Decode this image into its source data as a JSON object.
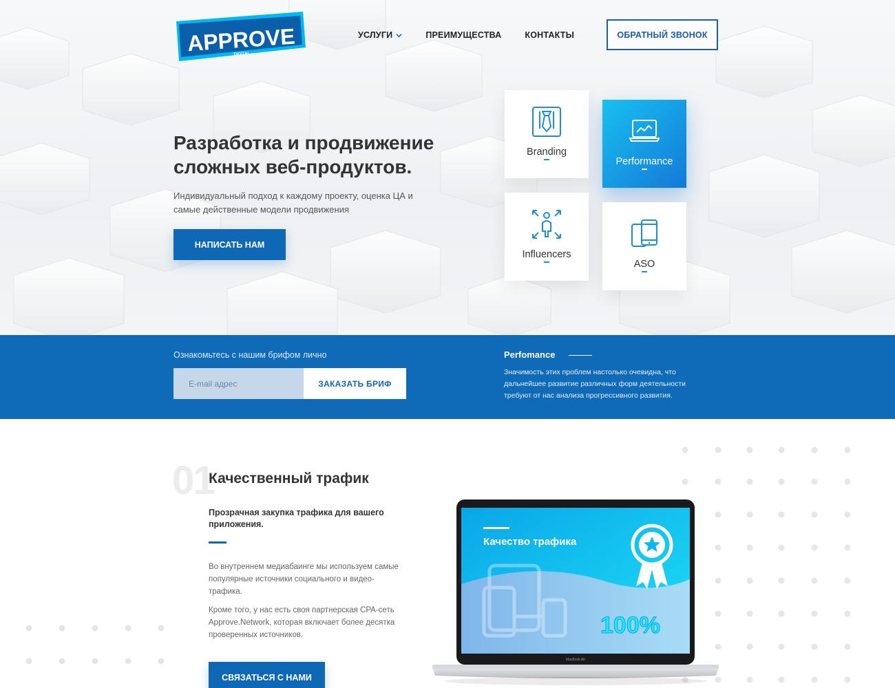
{
  "logo": {
    "main": "APPROVE",
    "sub": "DIGITAL"
  },
  "nav": {
    "items": [
      {
        "label": "УСЛУГИ"
      },
      {
        "label": "ПРЕИМУЩЕСТВА"
      },
      {
        "label": "КОНТАКТЫ"
      }
    ],
    "callback_label": "ОБРАТНЫЙ ЗВОНОК"
  },
  "hero": {
    "title": "Разработка и продвижение сложных веб-продуктов.",
    "subtitle": "Индивидуальный подход к каждому проекту, оценка ЦА и самые действенные модели продвижения",
    "cta_label": "НАПИСАТЬ НАМ"
  },
  "services": [
    {
      "label": "Branding",
      "icon": "tie-icon"
    },
    {
      "label": "Performance",
      "icon": "laptop-chart-icon",
      "active": true
    },
    {
      "label": "Influencers",
      "icon": "person-arrows-icon"
    },
    {
      "label": "ASO",
      "icon": "phones-icon"
    }
  ],
  "brief": {
    "label": "Ознакомьтесь с нашим брифом лично",
    "email_placeholder": "E-mail адрес",
    "button_label": "ЗАКАЗАТЬ БРИФ"
  },
  "performance_block": {
    "title": "Perfomance",
    "text": "Значимость этих проблем настолько очевидна, что дальнейшее развитие различных форм деятельности требуют от нас анализа прогрессивного развития."
  },
  "section": {
    "number": "01",
    "title": "Качественный трафик",
    "subtitle": "Прозрачная закупка трафика для вашего приложения.",
    "paragraph1": "Во внутреннем медиабаинге мы используем самые популярные источники социального и видео-трафика.",
    "paragraph2": "Кроме того, у нас есть своя партнерская CPA-сеть Approve.Network, которая включает более десятка проверенных источников.",
    "cta_label": "СВЯЗАТЬСЯ С НАМИ"
  },
  "laptop_screen": {
    "title": "Качество трафика",
    "percent": "100%",
    "model": "MacBook Air"
  },
  "colors": {
    "primary": "#0f68b6",
    "accent_cyan": "#18c0f0",
    "text_dark": "#333333"
  }
}
